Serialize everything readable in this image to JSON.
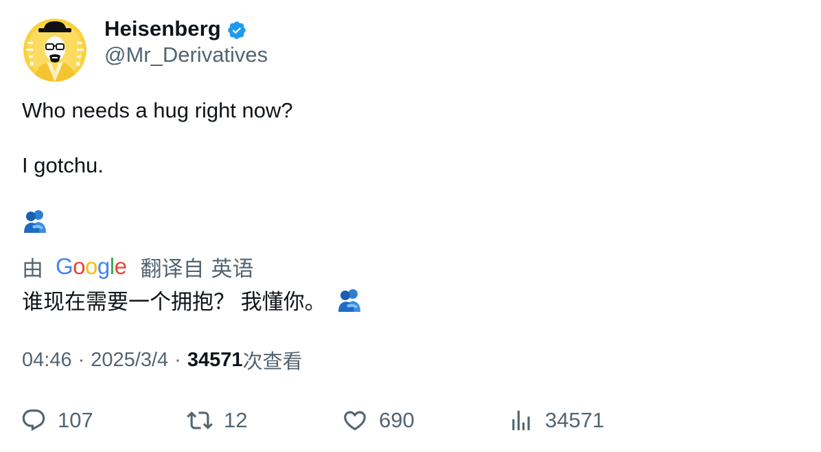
{
  "author": {
    "display_name": "Heisenberg",
    "handle": "@Mr_Derivatives",
    "verified": true,
    "avatar_icon": "heisenberg-avatar",
    "verified_icon": "verified-badge-icon"
  },
  "tweet": {
    "line1": "Who needs a hug right now?",
    "line2": "I gotchu.",
    "emoji": "people-hugging-emoji"
  },
  "translation": {
    "prefix": "由",
    "provider": "Google",
    "translated_from": "翻译自",
    "language": "英语",
    "text": "谁现在需要一个拥抱？ 我懂你。"
  },
  "meta": {
    "time": "04:46",
    "separator": "·",
    "date": "2025/3/4",
    "views_count": "34571",
    "views_label": "次查看"
  },
  "actions": {
    "reply_count": "107",
    "retweet_count": "12",
    "like_count": "690",
    "views_count": "34571"
  },
  "colors": {
    "primary_text": "#0f1419",
    "secondary_text": "#536471",
    "verified_blue": "#1d9bf0",
    "avatar_yellow": "#f9d13e"
  }
}
